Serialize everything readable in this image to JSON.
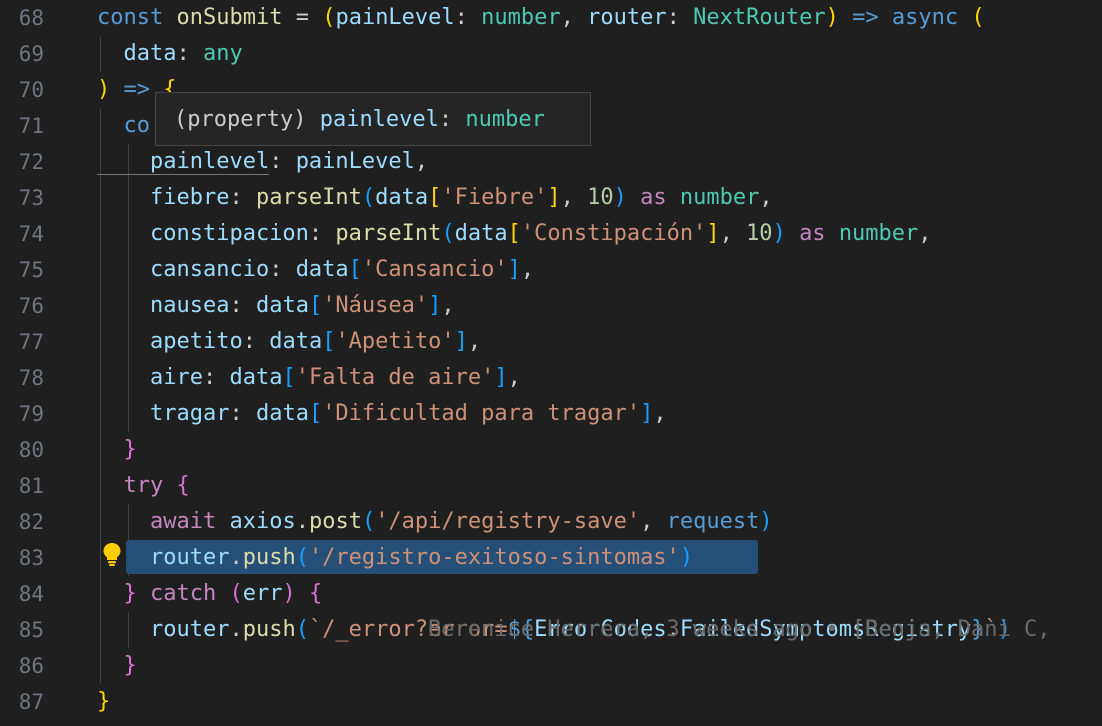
{
  "hover": {
    "kind": "(property)",
    "name": "painlevel",
    "colon": ":",
    "type": "number"
  },
  "blame": {
    "text": "Berenice Herrera, 3 weeks ago • [Benja, Dani C,"
  },
  "colors": {
    "keyword": "#569cd6",
    "control": "#c586c0",
    "variable": "#9cdcfe",
    "function": "#dcdcaa",
    "type": "#4ec9b0",
    "string": "#ce9178",
    "number": "#b5cea8",
    "bracket_gold": "#ffd700",
    "bracket_purple": "#da70d6",
    "bracket_blue": "#179fff",
    "plain": "#cccccc",
    "selection": "#264f78",
    "line_number": "#6e7681"
  },
  "lines": [
    {
      "n": "68",
      "tokens": [
        [
          "const",
          "keyword"
        ],
        [
          " ",
          "plain"
        ],
        [
          "onSubmit",
          "function"
        ],
        [
          " = ",
          "plain"
        ],
        [
          "(",
          "bracket_gold"
        ],
        [
          "painLevel",
          "variable"
        ],
        [
          ": ",
          "plain"
        ],
        [
          "number",
          "type"
        ],
        [
          ", ",
          "plain"
        ],
        [
          "router",
          "variable"
        ],
        [
          ": ",
          "plain"
        ],
        [
          "NextRouter",
          "type"
        ],
        [
          ") ",
          "bracket_gold"
        ],
        [
          "=>",
          "keyword"
        ],
        [
          " ",
          "plain"
        ],
        [
          "async",
          "keyword"
        ],
        [
          " (",
          "bracket_gold"
        ]
      ]
    },
    {
      "n": "69",
      "tokens": [
        [
          "  data",
          "variable"
        ],
        [
          ": ",
          "plain"
        ],
        [
          "any",
          "type"
        ]
      ]
    },
    {
      "n": "70",
      "tokens": [
        [
          ")",
          "bracket_gold"
        ],
        [
          " ",
          "plain"
        ],
        [
          "=>",
          "keyword"
        ],
        [
          " ",
          "plain"
        ],
        [
          "{",
          "bracket_gold"
        ]
      ]
    },
    {
      "n": "71",
      "tokens": [
        [
          "  co",
          "keyword"
        ]
      ]
    },
    {
      "n": "72",
      "tokens": [
        [
          "    painlevel",
          "variable"
        ],
        [
          ": ",
          "plain"
        ],
        [
          "painLevel",
          "variable"
        ],
        [
          ",",
          "plain"
        ]
      ]
    },
    {
      "n": "73",
      "tokens": [
        [
          "    fiebre",
          "variable"
        ],
        [
          ": ",
          "plain"
        ],
        [
          "parseInt",
          "function"
        ],
        [
          "(",
          "bracket_blue"
        ],
        [
          "data",
          "variable"
        ],
        [
          "[",
          "bracket_gold"
        ],
        [
          "'Fiebre'",
          "string"
        ],
        [
          "]",
          "bracket_gold"
        ],
        [
          ", ",
          "plain"
        ],
        [
          "10",
          "number"
        ],
        [
          ")",
          "bracket_blue"
        ],
        [
          " ",
          "plain"
        ],
        [
          "as",
          "control"
        ],
        [
          " ",
          "plain"
        ],
        [
          "number",
          "type"
        ],
        [
          ",",
          "plain"
        ]
      ]
    },
    {
      "n": "74",
      "tokens": [
        [
          "    constipacion",
          "variable"
        ],
        [
          ": ",
          "plain"
        ],
        [
          "parseInt",
          "function"
        ],
        [
          "(",
          "bracket_blue"
        ],
        [
          "data",
          "variable"
        ],
        [
          "[",
          "bracket_gold"
        ],
        [
          "'Constipación'",
          "string"
        ],
        [
          "]",
          "bracket_gold"
        ],
        [
          ", ",
          "plain"
        ],
        [
          "10",
          "number"
        ],
        [
          ")",
          "bracket_blue"
        ],
        [
          " ",
          "plain"
        ],
        [
          "as",
          "control"
        ],
        [
          " ",
          "plain"
        ],
        [
          "number",
          "type"
        ],
        [
          ",",
          "plain"
        ]
      ]
    },
    {
      "n": "75",
      "tokens": [
        [
          "    cansancio",
          "variable"
        ],
        [
          ": ",
          "plain"
        ],
        [
          "data",
          "variable"
        ],
        [
          "[",
          "bracket_blue"
        ],
        [
          "'Cansancio'",
          "string"
        ],
        [
          "]",
          "bracket_blue"
        ],
        [
          ",",
          "plain"
        ]
      ]
    },
    {
      "n": "76",
      "tokens": [
        [
          "    nausea",
          "variable"
        ],
        [
          ": ",
          "plain"
        ],
        [
          "data",
          "variable"
        ],
        [
          "[",
          "bracket_blue"
        ],
        [
          "'Náusea'",
          "string"
        ],
        [
          "]",
          "bracket_blue"
        ],
        [
          ",",
          "plain"
        ]
      ]
    },
    {
      "n": "77",
      "tokens": [
        [
          "    apetito",
          "variable"
        ],
        [
          ": ",
          "plain"
        ],
        [
          "data",
          "variable"
        ],
        [
          "[",
          "bracket_blue"
        ],
        [
          "'Apetito'",
          "string"
        ],
        [
          "]",
          "bracket_blue"
        ],
        [
          ",",
          "plain"
        ]
      ]
    },
    {
      "n": "78",
      "tokens": [
        [
          "    aire",
          "variable"
        ],
        [
          ": ",
          "plain"
        ],
        [
          "data",
          "variable"
        ],
        [
          "[",
          "bracket_blue"
        ],
        [
          "'Falta de aire'",
          "string"
        ],
        [
          "]",
          "bracket_blue"
        ],
        [
          ",",
          "plain"
        ]
      ]
    },
    {
      "n": "79",
      "tokens": [
        [
          "    tragar",
          "variable"
        ],
        [
          ": ",
          "plain"
        ],
        [
          "data",
          "variable"
        ],
        [
          "[",
          "bracket_blue"
        ],
        [
          "'Dificultad para tragar'",
          "string"
        ],
        [
          "]",
          "bracket_blue"
        ],
        [
          ",",
          "plain"
        ]
      ]
    },
    {
      "n": "80",
      "tokens": [
        [
          "  ",
          "plain"
        ],
        [
          "}",
          "bracket_purple"
        ]
      ]
    },
    {
      "n": "81",
      "tokens": [
        [
          "  try",
          "control"
        ],
        [
          " ",
          "plain"
        ],
        [
          "{",
          "bracket_purple"
        ]
      ]
    },
    {
      "n": "82",
      "tokens": [
        [
          "    await",
          "control"
        ],
        [
          " ",
          "plain"
        ],
        [
          "axios",
          "variable"
        ],
        [
          ".",
          "plain"
        ],
        [
          "post",
          "function"
        ],
        [
          "(",
          "bracket_blue"
        ],
        [
          "'/api/registry-save'",
          "string"
        ],
        [
          ", ",
          "plain"
        ],
        [
          "request",
          "keyword"
        ],
        [
          ")",
          "bracket_blue"
        ]
      ]
    },
    {
      "n": "83",
      "tokens": [
        [
          "    router",
          "variable"
        ],
        [
          ".",
          "plain"
        ],
        [
          "push",
          "function"
        ],
        [
          "(",
          "bracket_blue"
        ],
        [
          "'/registro-exitoso-sintomas'",
          "string"
        ],
        [
          ")",
          "bracket_blue"
        ]
      ]
    },
    {
      "n": "84",
      "tokens": [
        [
          "  ",
          "plain"
        ],
        [
          "}",
          "bracket_purple"
        ],
        [
          " ",
          "plain"
        ],
        [
          "catch",
          "control"
        ],
        [
          " ",
          "plain"
        ],
        [
          "(",
          "bracket_purple"
        ],
        [
          "err",
          "variable"
        ],
        [
          ")",
          "bracket_purple"
        ],
        [
          " ",
          "plain"
        ],
        [
          "{",
          "bracket_purple"
        ]
      ]
    },
    {
      "n": "85",
      "tokens": [
        [
          "    router",
          "variable"
        ],
        [
          ".",
          "plain"
        ],
        [
          "push",
          "function"
        ],
        [
          "(",
          "bracket_blue"
        ],
        [
          "`/_error?error=",
          "string"
        ],
        [
          "${",
          "keyword"
        ],
        [
          "ErrorCodes",
          "variable"
        ],
        [
          ".",
          "plain"
        ],
        [
          "FailedSymptomsRegistry",
          "variable"
        ],
        [
          "}",
          "keyword"
        ],
        [
          "`",
          "string"
        ],
        [
          ")",
          "bracket_blue"
        ]
      ]
    },
    {
      "n": "86",
      "tokens": [
        [
          "  ",
          "plain"
        ],
        [
          "}",
          "bracket_purple"
        ]
      ]
    },
    {
      "n": "87",
      "tokens": [
        [
          "}",
          "bracket_gold"
        ]
      ]
    }
  ]
}
